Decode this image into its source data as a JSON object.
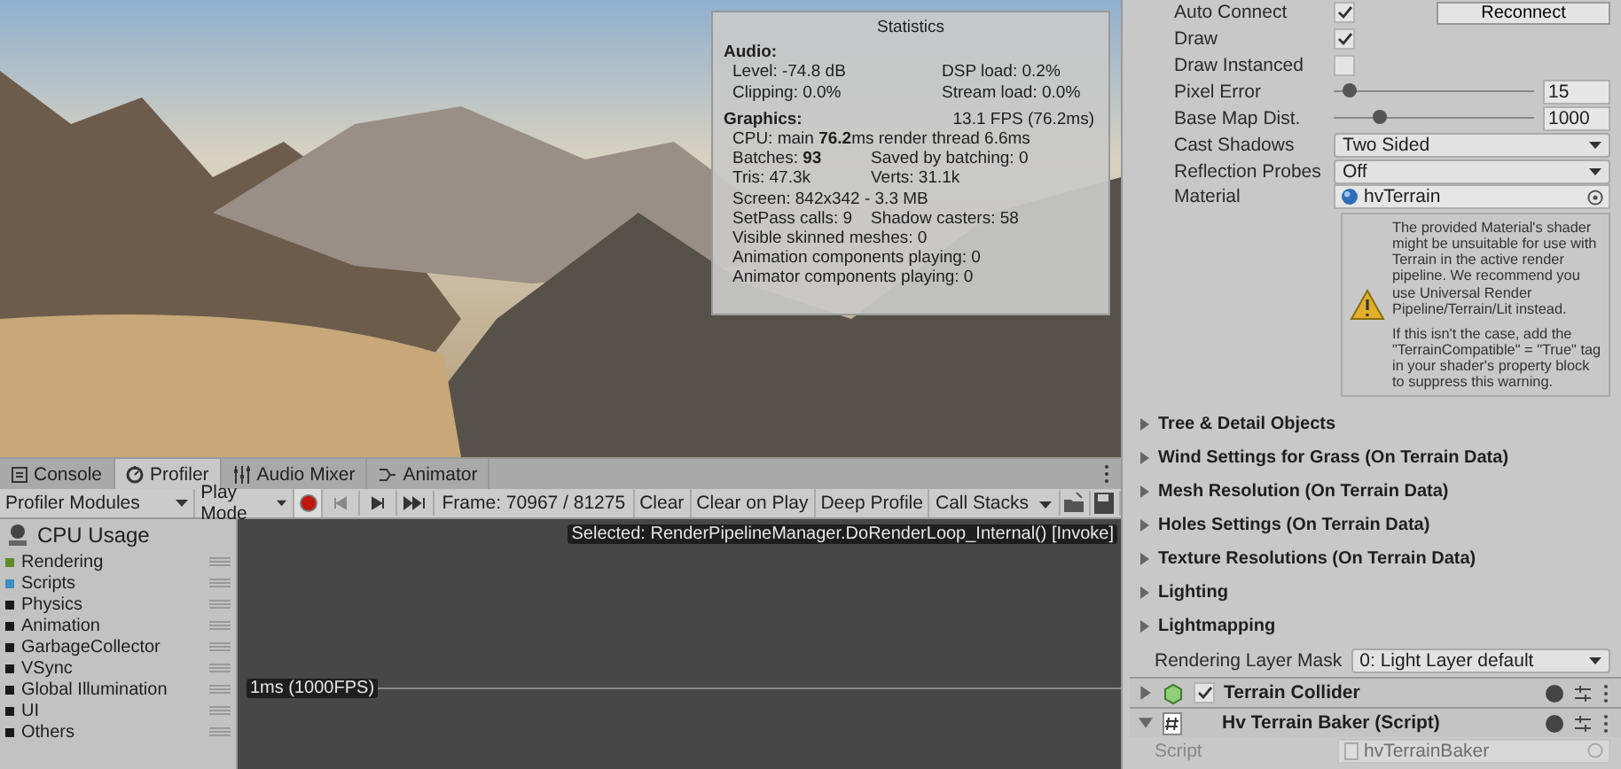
{
  "scene_view": {
    "statistics": {
      "title": "Statistics",
      "audio_heading": "Audio:",
      "audio": [
        {
          "left": "Level: -74.8 dB",
          "right": "DSP load: 0.2%"
        },
        {
          "left": "Clipping: 0.0%",
          "right": "Stream load: 0.0%"
        }
      ],
      "graphics_heading": "Graphics:",
      "fps": "13.1 FPS (76.2ms)",
      "graphics": [
        {
          "left": "CPU: main **76.2**ms  render thread 6.6ms"
        },
        {
          "left": "Batches: **93**",
          "right": "Saved by batching: 0"
        },
        {
          "left": "Tris: 47.3k",
          "right": "Verts: 31.1k"
        },
        {
          "left": "Screen: 842x342 - 3.3 MB"
        },
        {
          "left": "SetPass calls: 9",
          "right": "Shadow casters: 58"
        },
        {
          "left": "Visible skinned meshes: 0"
        },
        {
          "left": "Animation components playing: 0"
        },
        {
          "left": "Animator components playing: 0"
        }
      ]
    }
  },
  "profiler": {
    "tabs": [
      {
        "label": "Console",
        "selected": false
      },
      {
        "label": "Profiler",
        "selected": true
      },
      {
        "label": "Audio Mixer",
        "selected": false
      },
      {
        "label": "Animator",
        "selected": false
      }
    ],
    "modules_dropdown": "Profiler Modules",
    "mode_dropdown": "Play Mode",
    "recording": true,
    "frame": "Frame: 70967 / 81275",
    "buttons": [
      "Clear",
      "Clear on Play",
      "Deep Profile"
    ],
    "call_stacks": "Call Stacks",
    "module": {
      "title": "CPU Usage",
      "items": [
        {
          "label": "Rendering",
          "color": "#5f8a2a"
        },
        {
          "label": "Scripts",
          "color": "#3d8fbf"
        },
        {
          "label": "Physics",
          "color": "#1a1a1a"
        },
        {
          "label": "Animation",
          "color": "#1a1a1a"
        },
        {
          "label": "GarbageCollector",
          "color": "#1a1a1a"
        },
        {
          "label": "VSync",
          "color": "#1a1a1a"
        },
        {
          "label": "Global Illumination",
          "color": "#1a1a1a"
        },
        {
          "label": "UI",
          "color": "#1a1a1a"
        },
        {
          "label": "Others",
          "color": "#1a1a1a"
        }
      ]
    },
    "chart": {
      "selected": "Selected: RenderPipelineManager.DoRenderLoop_Internal() [Invoke]",
      "marker": "1ms (1000FPS)"
    }
  },
  "inspector": {
    "rows": [
      {
        "kind": "toggle",
        "label": "Auto Connect",
        "checked": true,
        "button": "Reconnect"
      },
      {
        "kind": "toggle",
        "label": "Draw",
        "checked": true
      },
      {
        "kind": "toggle",
        "label": "Draw Instanced",
        "checked": false
      },
      {
        "kind": "slider",
        "label": "Pixel Error",
        "level": 0.09,
        "value": "15"
      },
      {
        "kind": "slider",
        "label": "Base Map Dist.",
        "level": 0.24,
        "value": "1000"
      },
      {
        "kind": "dropdown",
        "label": "Cast Shadows",
        "value": "Two Sided"
      },
      {
        "kind": "dropdown",
        "label": "Reflection Probes",
        "value": "Off"
      },
      {
        "kind": "object",
        "label": "Material",
        "value": "hvTerrain"
      }
    ],
    "warning": [
      "The provided Material's shader might be unsuitable for use with Terrain in the active render pipeline. We recommend you use Universal Render Pipeline/Terrain/Lit instead.",
      "If this isn't the case, add the \"TerrainCompatible\" = \"True\" tag in your shader's property block to suppress this warning."
    ],
    "foldouts": [
      {
        "label": "Tree & Detail Objects",
        "expanded": false
      },
      {
        "label": "Wind Settings for Grass (On Terrain Data)",
        "expanded": false
      },
      {
        "label": "Mesh Resolution (On Terrain Data)",
        "expanded": false
      },
      {
        "label": "Holes Settings (On Terrain Data)",
        "expanded": false
      },
      {
        "label": "Texture Resolutions (On Terrain Data)",
        "expanded": false
      },
      {
        "label": "Lighting",
        "expanded": false
      },
      {
        "label": "Lightmapping",
        "expanded": false
      }
    ],
    "layer_mask": {
      "label": "Rendering Layer Mask",
      "value": "0: Light Layer default"
    },
    "components": [
      {
        "kind": "collider",
        "title": "Terrain Collider",
        "expanded": false,
        "enabled": true
      },
      {
        "kind": "script",
        "title": "Hv Terrain Baker (Script)",
        "expanded": true
      }
    ],
    "script_field": {
      "label": "Script",
      "value": "hvTerrainBaker"
    }
  }
}
